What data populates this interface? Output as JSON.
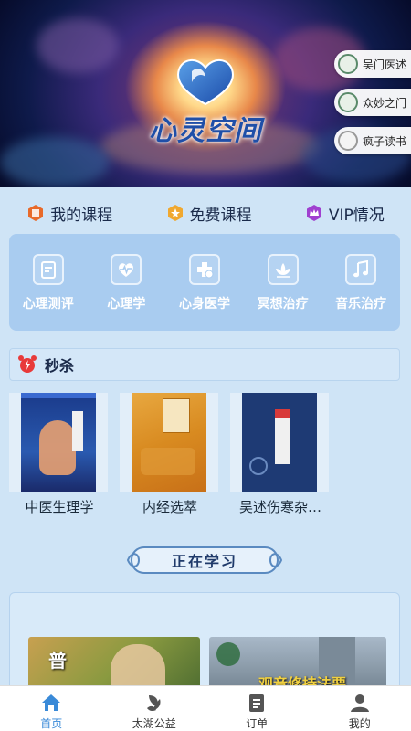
{
  "banner": {
    "brand": "心灵空间"
  },
  "side_buttons": [
    {
      "label": "吴门医述"
    },
    {
      "label": "众妙之门"
    },
    {
      "label": "疯子读书"
    }
  ],
  "course_tabs": [
    {
      "label": "我的课程",
      "icon": "hexagon-course-icon",
      "color": "#e86a2a"
    },
    {
      "label": "免费课程",
      "icon": "star-hexagon-icon",
      "color": "#f0a830"
    },
    {
      "label": "VIP情况",
      "icon": "crown-hexagon-icon",
      "color": "#a040d0"
    }
  ],
  "categories": [
    {
      "label": "心理测评",
      "icon": "clipboard-icon"
    },
    {
      "label": "心理学",
      "icon": "heartbeat-icon"
    },
    {
      "label": "心身医学",
      "icon": "medical-cross-icon"
    },
    {
      "label": "冥想治疗",
      "icon": "lotus-icon"
    },
    {
      "label": "音乐治疗",
      "icon": "music-note-icon"
    }
  ],
  "flash_sale": {
    "label": "秒杀",
    "icon": "alarm-clock-icon"
  },
  "books": [
    {
      "title": "中医生理学"
    },
    {
      "title": "内经选萃"
    },
    {
      "title": "吴述伤寒杂…"
    }
  ],
  "studying": {
    "title": "正在学习",
    "thumbs": [
      {
        "text": "普"
      },
      {
        "text": "观音修持法要"
      }
    ]
  },
  "bottom_nav": [
    {
      "label": "首页",
      "icon": "home-icon",
      "active": true
    },
    {
      "label": "太湖公益",
      "icon": "leaf-charity-icon",
      "active": false
    },
    {
      "label": "订单",
      "icon": "order-list-icon",
      "active": false
    },
    {
      "label": "我的",
      "icon": "user-icon",
      "active": false
    }
  ],
  "colors": {
    "accent": "#3a8ad8",
    "category_card": "#a9ccf0",
    "background": "#cfe4f6"
  }
}
